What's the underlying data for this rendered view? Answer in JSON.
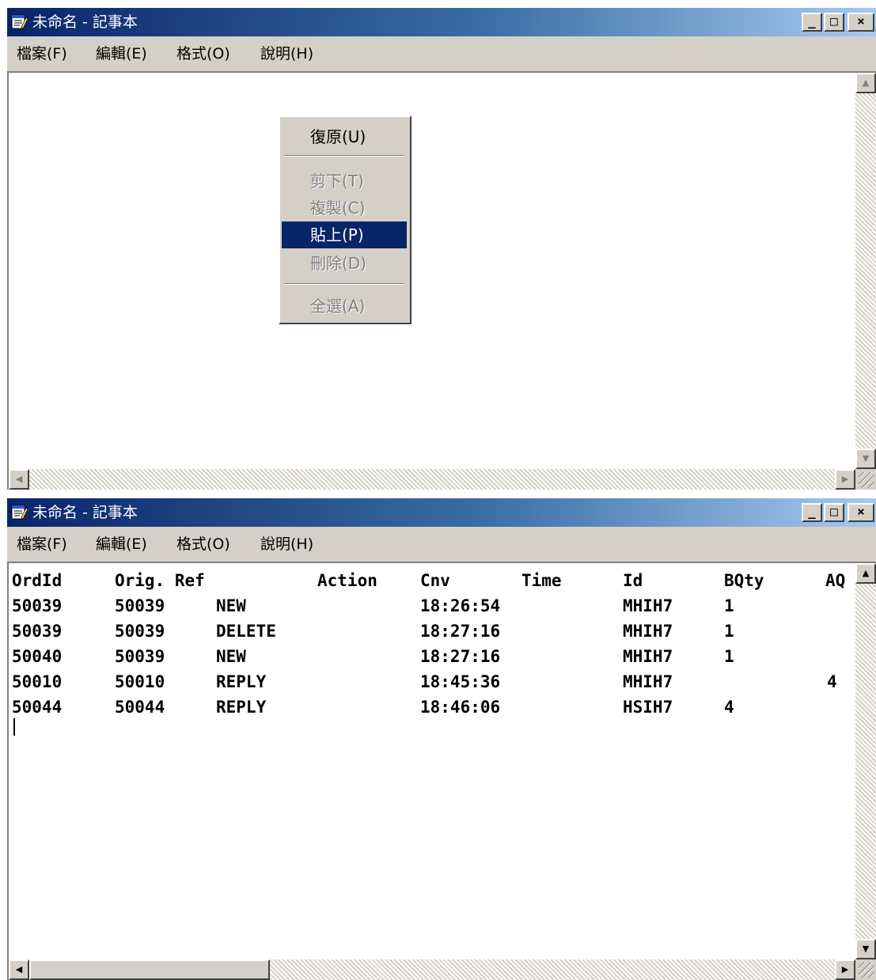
{
  "windows": [
    {
      "title": "未命名 - 記事本",
      "menu": [
        "檔案(F)",
        "編輯(E)",
        "格式(O)",
        "說明(H)"
      ],
      "context_menu": {
        "items": [
          {
            "label": "復原(U)",
            "state": "enabled"
          },
          {
            "label": "剪下(T)",
            "state": "disabled"
          },
          {
            "label": "複製(C)",
            "state": "disabled"
          },
          {
            "label": "貼上(P)",
            "state": "selected"
          },
          {
            "label": "刪除(D)",
            "state": "disabled"
          },
          {
            "label": "全選(A)",
            "state": "disabled"
          }
        ]
      }
    },
    {
      "title": "未命名 - 記事本",
      "menu": [
        "檔案(F)",
        "編輯(E)",
        "格式(O)",
        "說明(H)"
      ],
      "header_row": {
        "c1": "OrdId",
        "c2": "Orig. Ref",
        "c3": "Action",
        "c4": "Cnv",
        "c5": "Time",
        "c6": "Id",
        "c7": "BQty",
        "c8": "AQ"
      },
      "rows": [
        {
          "ord": "50039",
          "orig": "50039",
          "action": "NEW",
          "time": "18:26:54",
          "id": "MHIH7",
          "bqty": "1",
          "aqty": ""
        },
        {
          "ord": "50039",
          "orig": "50039",
          "action": "DELETE",
          "time": "18:27:16",
          "id": "MHIH7",
          "bqty": "1",
          "aqty": ""
        },
        {
          "ord": "50040",
          "orig": "50039",
          "action": "NEW",
          "time": "18:27:16",
          "id": "MHIH7",
          "bqty": "1",
          "aqty": ""
        },
        {
          "ord": "50010",
          "orig": "50010",
          "action": "REPLY",
          "time": "18:45:36",
          "id": "MHIH7",
          "bqty": "",
          "aqty": "4"
        },
        {
          "ord": "50044",
          "orig": "50044",
          "action": "REPLY",
          "time": "18:46:06",
          "id": "HSIH7",
          "bqty": "4",
          "aqty": ""
        }
      ]
    }
  ],
  "window_buttons": {
    "minimize": "_",
    "maximize": "□",
    "close": "×"
  },
  "icons": {
    "app": "notepad-icon",
    "up": "▲",
    "down": "▼",
    "left": "◀",
    "right": "▶"
  },
  "colors": {
    "title_start": "#0a246a",
    "title_end": "#a6caf0",
    "selection": "#0a246a",
    "face": "#d4d0c8"
  }
}
